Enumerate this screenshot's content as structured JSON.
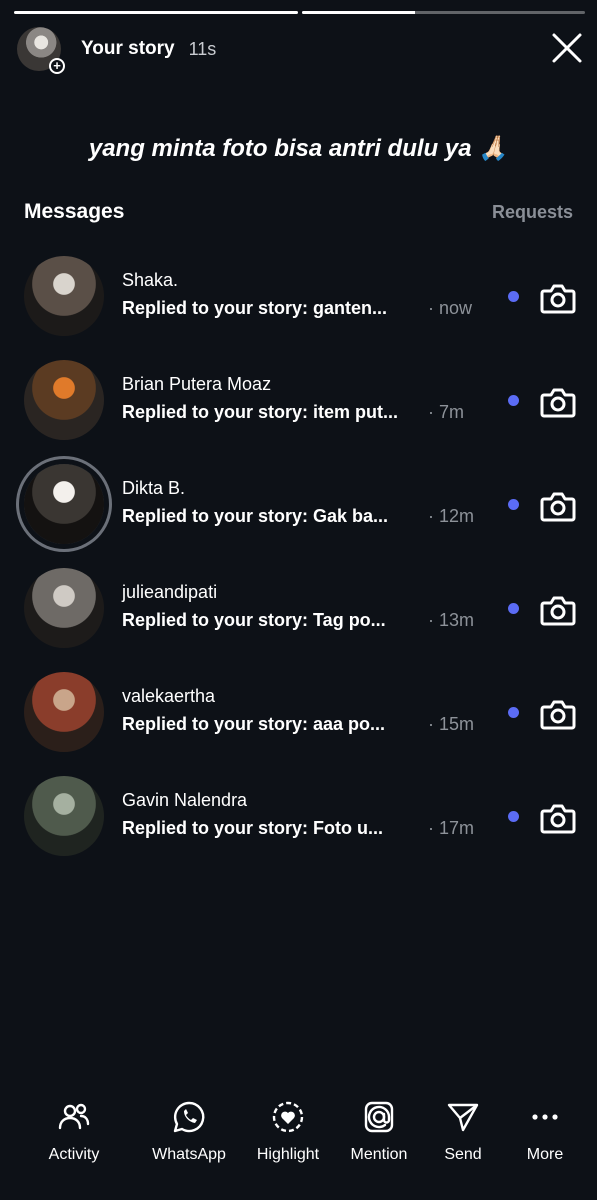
{
  "progress": [
    {
      "fill": 1.0
    },
    {
      "fill": 0.4
    }
  ],
  "header": {
    "title": "Your story",
    "time": "11s",
    "close_icon": "close-icon"
  },
  "caption": "yang minta foto bisa antri dulu ya 🙏🏻",
  "messages_section": {
    "title": "Messages",
    "requests_label": "Requests"
  },
  "messages": [
    {
      "name": "Shaka.",
      "preview": "Replied to your story: ganten...",
      "time": "· now",
      "avatar_colors": [
        "#d9d4cd",
        "#5a4f47",
        "#1c1a19"
      ],
      "ring": false
    },
    {
      "name": "Brian Putera Moaz",
      "preview": "Replied to your story: item put...",
      "time": "· 7m",
      "avatar_colors": [
        "#e07a2a",
        "#5b3b22",
        "#2a2522"
      ],
      "ring": false
    },
    {
      "name": "Dikta B.",
      "preview": "Replied to your story: Gak ba...",
      "time": "· 12m",
      "avatar_colors": [
        "#f3f0ec",
        "#3a3632",
        "#141211"
      ],
      "ring": true
    },
    {
      "name": "julieandipati",
      "preview": "Replied to your story: Tag po...",
      "time": "· 13m",
      "avatar_colors": [
        "#cfcac4",
        "#6e6a66",
        "#1d1b1a"
      ],
      "ring": false
    },
    {
      "name": "valekaertha",
      "preview": "Replied to your story: aaa po...",
      "time": "· 15m",
      "avatar_colors": [
        "#c9a58a",
        "#8a3d2b",
        "#2b1f1a"
      ],
      "ring": false
    },
    {
      "name": "Gavin Nalendra",
      "preview": "Replied to your story: Foto u...",
      "time": "· 17m",
      "avatar_colors": [
        "#a5b0a0",
        "#4f5a4c",
        "#1f2420"
      ],
      "ring": false
    }
  ],
  "unread_color": "#5b6cf5",
  "actions": [
    {
      "label": "Activity",
      "icon": "activity-icon"
    },
    {
      "label": "WhatsApp",
      "icon": "whatsapp-icon"
    },
    {
      "label": "Highlight",
      "icon": "highlight-icon"
    },
    {
      "label": "Mention",
      "icon": "mention-icon"
    },
    {
      "label": "Send",
      "icon": "send-icon"
    },
    {
      "label": "More",
      "icon": "more-icon"
    }
  ]
}
